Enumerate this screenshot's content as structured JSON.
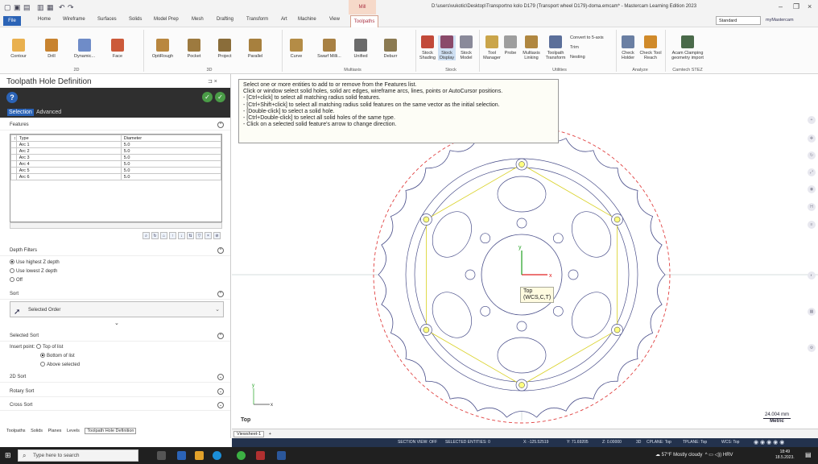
{
  "titlebar": {
    "document_title": "D:\\users\\vukotic\\Desktop\\Transportno kolo D179 (Transport wheel D179)-doma.emcam* - Mastercam Learning Edition 2023",
    "context_tab": "Mill"
  },
  "tabs": [
    "File",
    "Home",
    "Wireframe",
    "Surfaces",
    "Solids",
    "Model Prep",
    "Mesh",
    "Drafting",
    "Transform",
    "Art",
    "Machine",
    "View",
    "Toolpaths"
  ],
  "top_right": {
    "config_select": "Standard",
    "account": "myMastercam"
  },
  "ribbon": {
    "buttons_2d": [
      "Contour",
      "Drill",
      "Dynamic...",
      "Face"
    ],
    "buttons_3d": [
      "OptiRough",
      "Pocket",
      "Project",
      "Parallel"
    ],
    "buttons_multiaxis": [
      "Curve",
      "Swarf Milli...",
      "Unified",
      "Deburr"
    ],
    "buttons_stock": [
      "Stock Shading",
      "Stock Display",
      "Stock Model"
    ],
    "buttons_utilities": [
      "Tool Manager",
      "Probe",
      "Multiaxis Linking",
      "Toolpath Transform",
      "Convert to 5-axis",
      "Trim",
      "Nesting"
    ],
    "buttons_analyze": [
      "Check Holder",
      "Check Tool Reach"
    ],
    "buttons_ctech": [
      "Acam Clamping geometry import"
    ],
    "groups": [
      "2D",
      "3D",
      "Multiaxis",
      "Stock",
      "Utilities",
      "Analyze",
      "Camtech STEZ"
    ]
  },
  "panel": {
    "title": "Toolpath Hole Definition",
    "pin": "p ×",
    "subtabs": [
      "Selection",
      "Advanced"
    ],
    "features_header": "Features",
    "columns": [
      "Type",
      "Diameter"
    ],
    "rows": [
      {
        "type": "Arc 1",
        "diameter": "5.0"
      },
      {
        "type": "Arc 2",
        "diameter": "5.0"
      },
      {
        "type": "Arc 3",
        "diameter": "5.0"
      },
      {
        "type": "Arc 4",
        "diameter": "5.0"
      },
      {
        "type": "Arc 5",
        "diameter": "5.0"
      },
      {
        "type": "Arc 6",
        "diameter": "5.0"
      }
    ],
    "depth_filters": {
      "header": "Depth Filters",
      "options": [
        "Use highest Z depth",
        "Use lowest Z depth",
        "Off"
      ],
      "selected": 0
    },
    "sort": {
      "header": "Sort",
      "value": "Selected Order"
    },
    "selected_sort": {
      "header": "Selected Sort",
      "insert_label": "Insert point:",
      "options": [
        "Top of list",
        "Bottom of list",
        "Above selected"
      ],
      "selected": 1
    },
    "collapsed_sections": [
      "2D Sort",
      "Rotary Sort",
      "Cross Sort"
    ],
    "bottom_tabs": [
      "Toolpaths",
      "Solids",
      "Planes",
      "Levels",
      "Toolpath Hole Definition"
    ]
  },
  "viewport": {
    "tooltip_lines": [
      "Select one or more entities to add to or remove from the Features list.",
      "Click or window select solid holes, solid arc edges, wireframe arcs, lines, points or AutoCursor positions.",
      "- [Ctrl+click] to select all matching radius solid features.",
      "- [Ctrl+Shift+click] to select all matching radius solid features on the same vector as the initial selection.",
      "- [Double-click] to select a solid hole.",
      "- [Ctrl+Double-click] to select all solid holes of the same type.",
      "- Click on a selected solid feature's arrow to change direction."
    ],
    "view_label": "Top",
    "cube_label_line1": "Top",
    "cube_label_line2": "(WCS,C,T)",
    "scale_value": "24.004 mm",
    "scale_unit": "Metric",
    "viewsheet_tab": "Viewsheet-1",
    "colors": {
      "part": "#4a4f8a",
      "circle": "#e04040",
      "yellow": "#d8d020",
      "axis_x": "#e02020",
      "axis_y": "#20a020"
    }
  },
  "statusbar": {
    "section_view": "SECTION VIEW: OFF",
    "selected_entities": "SELECTED ENTITIES: 0",
    "x": "X:  -125.52519",
    "y": "Y:  71.69205",
    "z": "Z:  0.00000",
    "mode": "3D",
    "cplane": "CPLANE: Top",
    "tplane": "TPLANE: Top",
    "wcs": "WCS: Top"
  },
  "taskbar": {
    "search_placeholder": "Type here to search",
    "weather": "57°F  Mostly cloudy",
    "lang": "HRV",
    "time": "18:49",
    "date": "18.5.2023."
  }
}
